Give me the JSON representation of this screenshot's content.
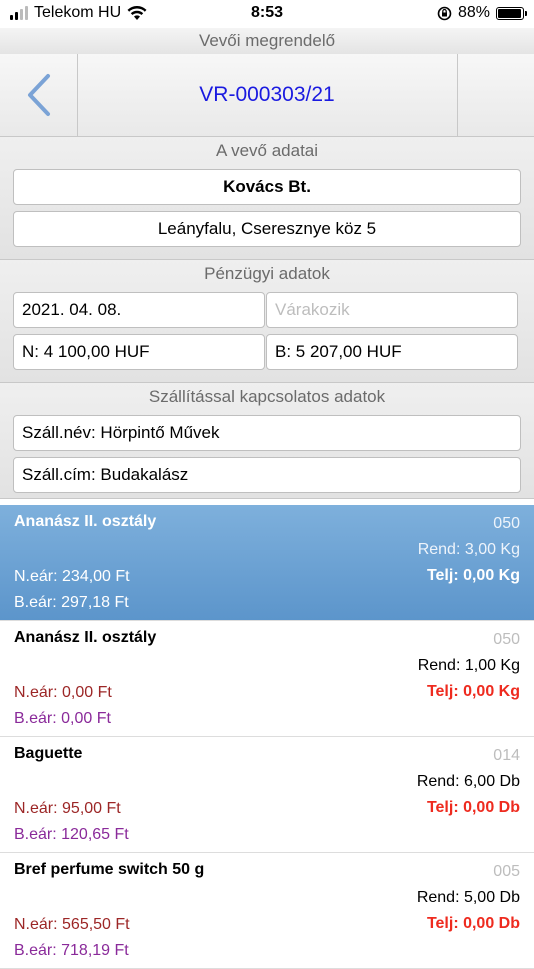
{
  "status_bar": {
    "carrier": "Telekom HU",
    "time": "8:53",
    "battery": "88%",
    "battery_level": 0.88
  },
  "header": {
    "screen_title": "Vevői megrendelő",
    "order_number": "VR-000303/21",
    "back_icon": "chevron-left-icon"
  },
  "customer": {
    "section_title": "A vevő adatai",
    "name": "Kovács Bt.",
    "address": "Leányfalu, Cseresznye köz 5"
  },
  "financial": {
    "section_title": "Pénzügyi adatok",
    "date": "2021. 04. 08.",
    "status_placeholder": "Várakozik",
    "net": "N: 4 100,00 HUF",
    "gross": "B: 5 207,00 HUF"
  },
  "shipping": {
    "section_title": "Szállítással kapcsolatos adatok",
    "name": "Száll.név: Hörpintő Művek",
    "address": "Száll.cím: Budakalász"
  },
  "items": [
    {
      "name": "Ananász II. osztály",
      "code": "050",
      "ordered": "Rend: 3,00 Kg",
      "net_price": "N.eár: 234,00 Ft",
      "fulfilled": "Telj: 0,00 Kg",
      "gross_price": "B.eár: 297,18 Ft",
      "selected": true
    },
    {
      "name": "Ananász II. osztály",
      "code": "050",
      "ordered": "Rend: 1,00 Kg",
      "net_price": "N.eár: 0,00 Ft",
      "fulfilled": "Telj: 0,00 Kg",
      "gross_price": "B.eár: 0,00 Ft",
      "selected": false
    },
    {
      "name": "Baguette",
      "code": "014",
      "ordered": "Rend: 6,00 Db",
      "net_price": "N.eár: 95,00 Ft",
      "fulfilled": "Telj: 0,00 Db",
      "gross_price": "B.eár: 120,65 Ft",
      "selected": false
    },
    {
      "name": "Bref perfume switch 50 g",
      "code": "005",
      "ordered": "Rend: 5,00 Db",
      "net_price": "N.eár: 565,50 Ft",
      "fulfilled": "Telj: 0,00 Db",
      "gross_price": "B.eár: 718,19 Ft",
      "selected": false
    }
  ]
}
